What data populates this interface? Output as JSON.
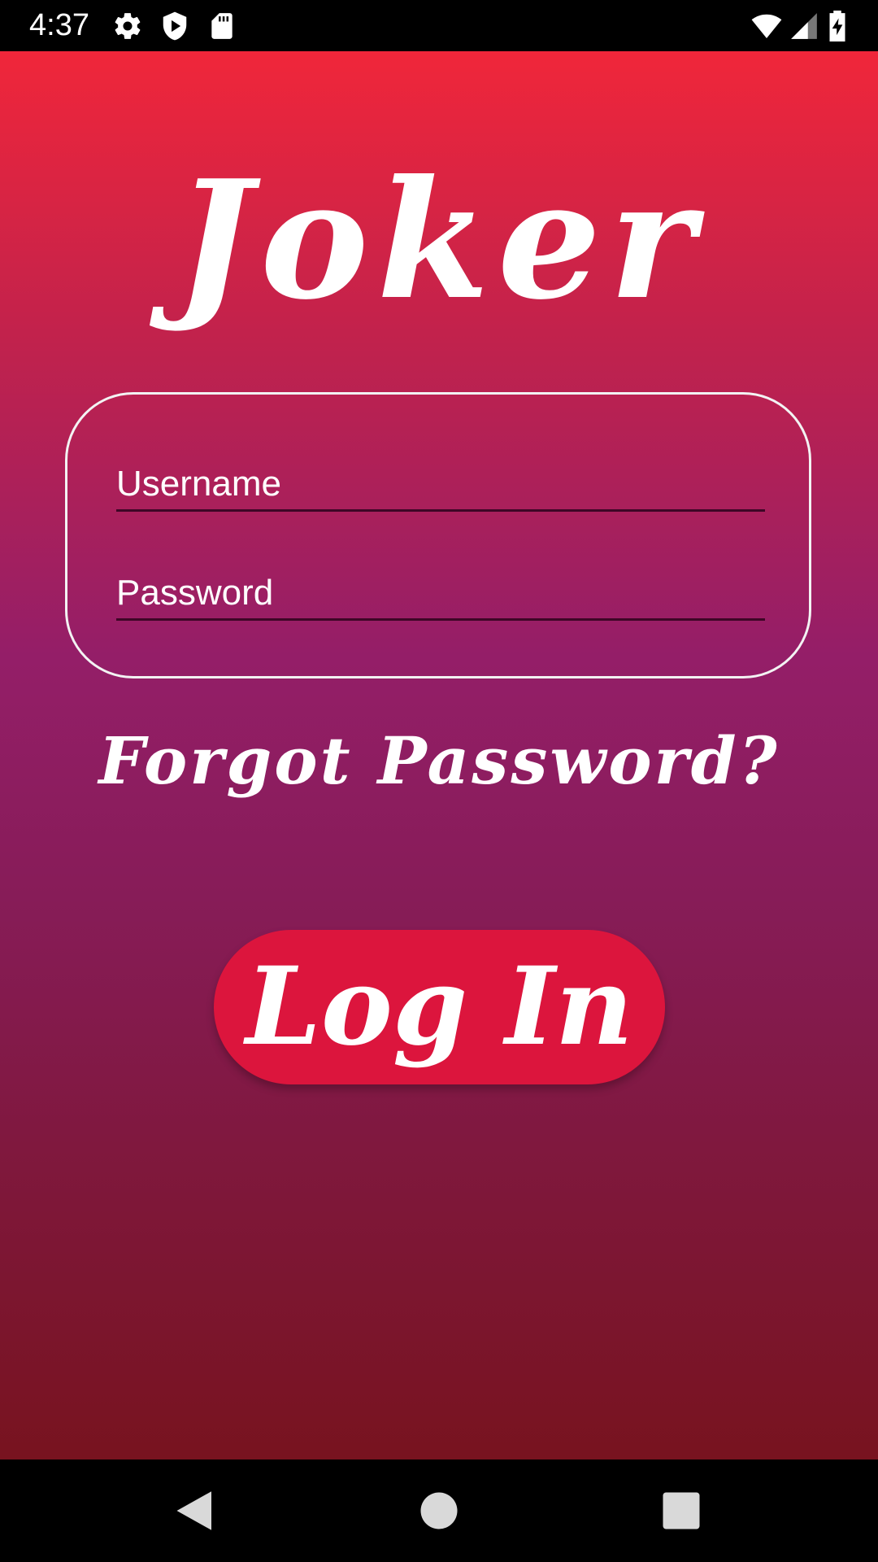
{
  "status_bar": {
    "time": "4:37",
    "icons": [
      "gear-icon",
      "shield-play-icon",
      "sd-card-icon",
      "wifi-icon",
      "cell-signal-icon",
      "battery-charging-icon"
    ]
  },
  "app": {
    "title": "Joker",
    "username": {
      "value": "",
      "placeholder": "Username"
    },
    "password": {
      "value": "",
      "placeholder": "Password"
    },
    "forgot_password": "Forgot Password?",
    "login_button": "Log In"
  },
  "nav_bar": {
    "icons": [
      "back-icon",
      "home-icon",
      "recents-icon"
    ]
  },
  "colors": {
    "gradient_top": "#f0263a",
    "gradient_middle": "#941e68",
    "gradient_bottom": "#78131f",
    "button": "#dc153d",
    "text": "#ffffff"
  }
}
